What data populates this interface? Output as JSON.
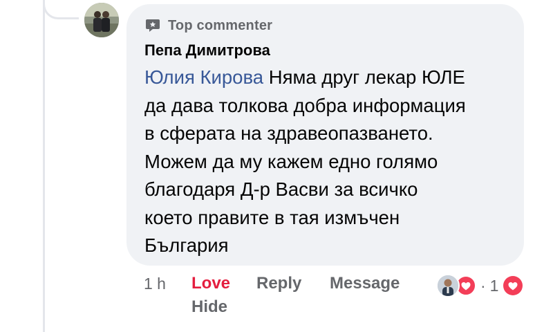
{
  "comment": {
    "badge": {
      "label": "Top commenter",
      "icon": "commenter-badge-icon"
    },
    "author": "Пепа Димитрова",
    "mention": "Юлия Кирова",
    "lines": [
      "Няма друг лекар ЮЛЕ",
      "да дава толкова добра информация",
      "в сферата на здравеопазването.",
      "Можем да му кажем едно голямо",
      "благодаря Д-р Васви за всичко",
      "което правите в тая измъчен",
      "България"
    ]
  },
  "actions": {
    "time": "1 h",
    "love": "Love",
    "reply": "Reply",
    "message": "Message",
    "hide": "Hide"
  },
  "reactions": {
    "separator": "·",
    "count": "1",
    "icons": [
      "reactor-avatar",
      "love-reaction-icon"
    ],
    "love_color": "#f33e58"
  },
  "colors": {
    "bubble": "#f0f2f5",
    "mention": "#385898",
    "love": "#e41e3f",
    "secondary_text": "#65676b"
  }
}
